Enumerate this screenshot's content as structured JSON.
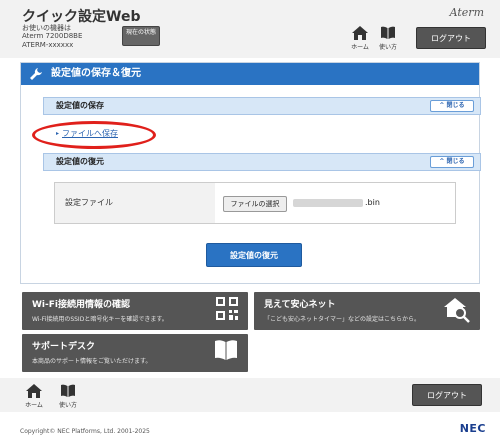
{
  "header": {
    "app_title": "クイック設定Web",
    "device_line1": "お使いの機器は",
    "device_line2": "Aterm 7200D8BE",
    "device_line3": "ATERM-xxxxxx",
    "status_button": "現在の状態",
    "brand_logo": "Aterm",
    "home_label": "ホーム",
    "help_label": "使い方",
    "logout_label": "ログアウト"
  },
  "panel": {
    "title": "設定値の保存＆復元",
    "save_section": {
      "title": "設定値の保存",
      "close_label": "閉じる",
      "link_label": "ファイルへ保存"
    },
    "restore_section": {
      "title": "設定値の復元",
      "close_label": "閉じる",
      "file_label": "設定ファイル",
      "choose_button": "ファイルの選択",
      "file_ext": ".bin"
    },
    "restore_button": "設定値の復元"
  },
  "tiles": {
    "wifi": {
      "title": "Wi-Fi接続用情報の確認",
      "desc": "Wi-Fi接続用のSSIDと暗号化キーを確認できます。"
    },
    "kids": {
      "title": "見えて安心ネット",
      "desc": "「こども安心ネットタイマー」などの設定はこちらから。"
    },
    "support": {
      "title": "サポートデスク",
      "desc": "本商品のサポート情報をご覧いただけます。"
    }
  },
  "footer": {
    "home_label": "ホーム",
    "help_label": "使い方",
    "logout_label": "ログアウト",
    "copyright": "Copyright© NEC Platforms, Ltd. 2001-2025",
    "nec_logo": "NEC"
  }
}
